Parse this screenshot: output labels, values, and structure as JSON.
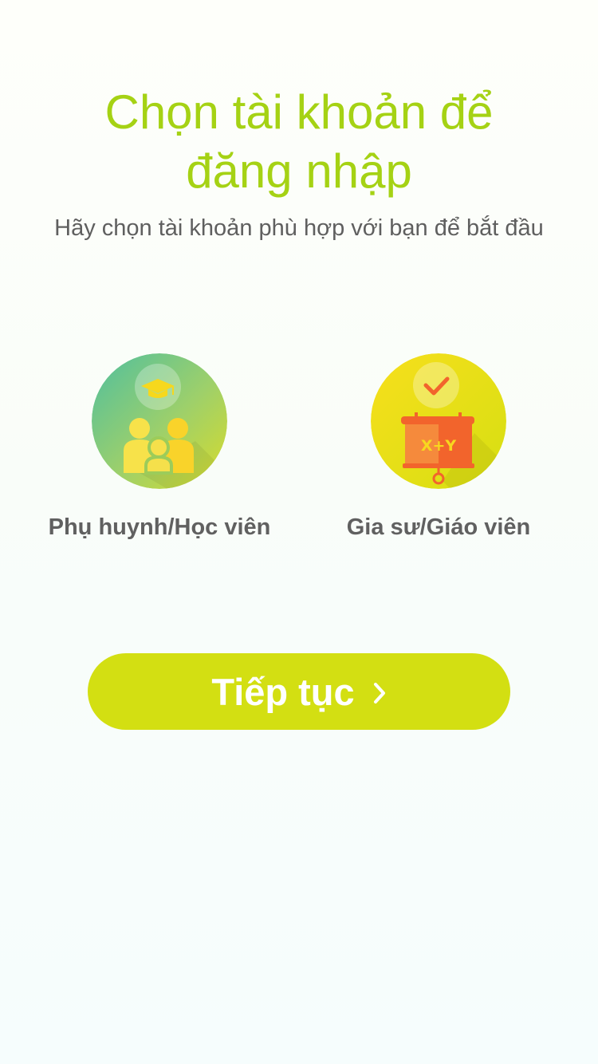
{
  "header": {
    "title_line1": "Chọn tài khoản để",
    "title_line2": "đăng nhập",
    "subtitle": "Hãy chọn tài khoản phù hợp với bạn để bắt đầu"
  },
  "account_options": [
    {
      "label": "Phụ huynh/Học viên",
      "icon": "family-graduation-cap-icon"
    },
    {
      "label": "Gia sư/Giáo viên",
      "icon": "teaching-board-checkmark-icon"
    }
  ],
  "actions": {
    "continue_label": "Tiếp tục",
    "continue_icon": "chevron-right-icon"
  },
  "colors": {
    "accent": "#a5d214",
    "button": "#d3df12",
    "text": "#606060"
  }
}
